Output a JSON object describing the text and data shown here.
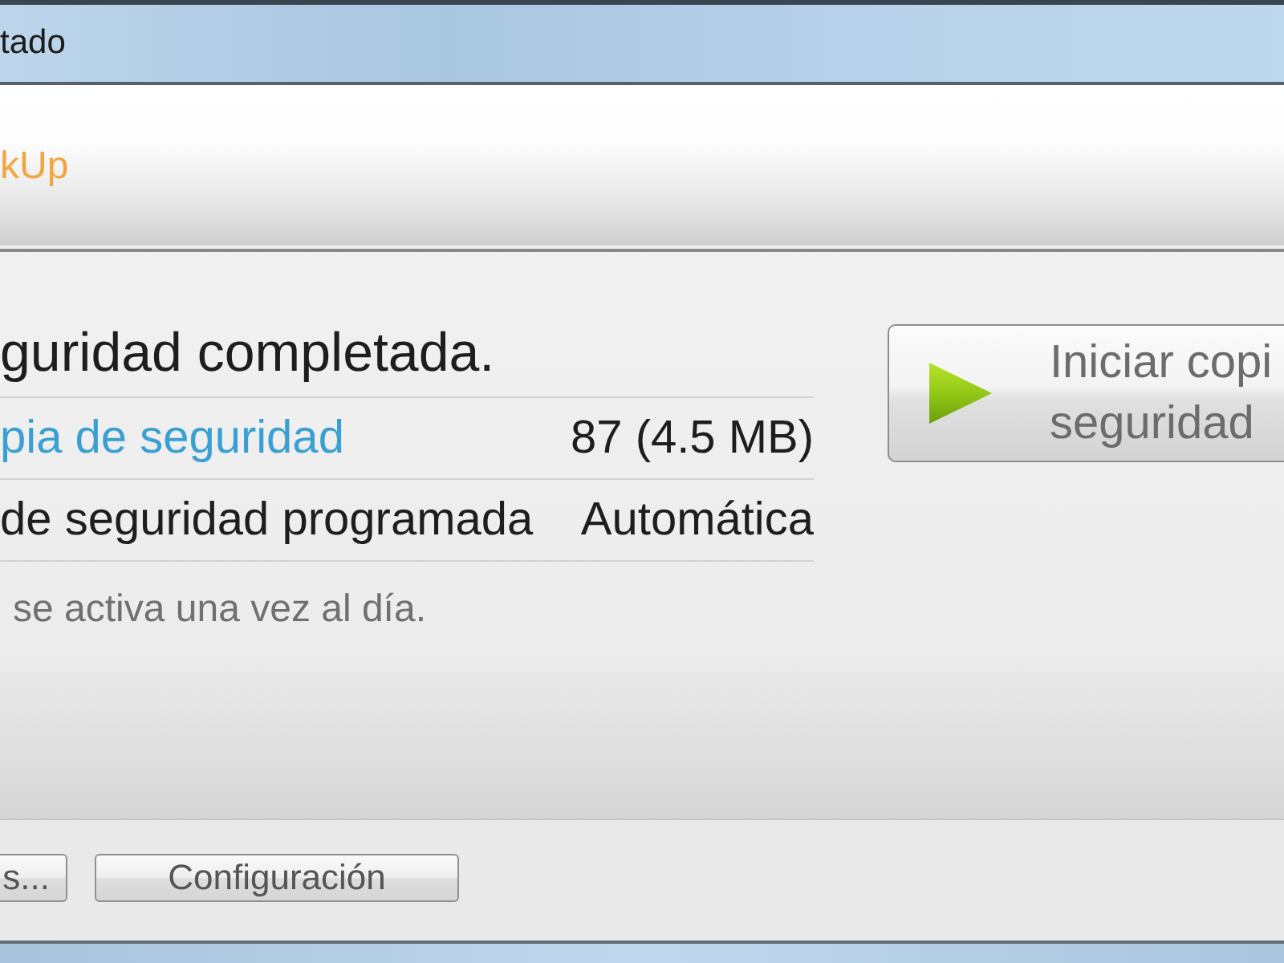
{
  "window": {
    "title": "tado"
  },
  "header": {
    "title": "kUp"
  },
  "status": {
    "message": "guridad completada."
  },
  "details": [
    {
      "kind": "link",
      "label": "pia de seguridad",
      "value": "87 (4.5 MB)"
    },
    {
      "kind": "text",
      "label": "de seguridad programada",
      "value": "Automática"
    }
  ],
  "note": "se activa una vez al día.",
  "start_button": {
    "label_lines": [
      "Iniciar copi",
      "seguridad"
    ]
  },
  "footer_buttons": [
    "s...",
    "Configuración"
  ]
}
